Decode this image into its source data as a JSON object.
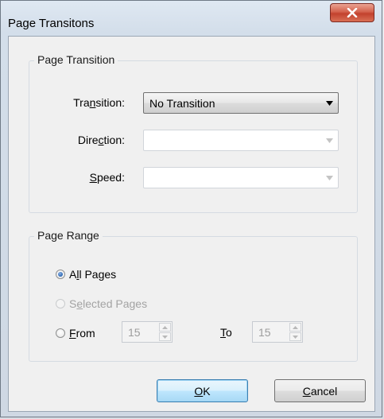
{
  "window": {
    "title": "Page Transitons",
    "close_icon": "close-x-icon",
    "accent_close_color": "#c7432e"
  },
  "page_transition": {
    "group_label": "Page Transition",
    "transition": {
      "label_pre": "Tra",
      "label_ul": "n",
      "label_post": "sition:",
      "value": "No Transition"
    },
    "direction": {
      "label_pre": "Dire",
      "label_ul": "c",
      "label_post": "tion:",
      "value": ""
    },
    "speed": {
      "label_pre": "",
      "label_ul": "S",
      "label_post": "peed:",
      "value": ""
    }
  },
  "page_range": {
    "group_label": "Page Range",
    "all_pages": {
      "label_pre": "A",
      "label_ul": "l",
      "label_post": "l Pages",
      "checked": true
    },
    "selected_pages": {
      "label_pre": "S",
      "label_ul": "e",
      "label_post": "lected Pages",
      "enabled": false
    },
    "from": {
      "label_pre": "",
      "label_ul": "F",
      "label_post": "rom",
      "value": "15"
    },
    "to": {
      "label_pre": "",
      "label_ul": "T",
      "label_post": "o",
      "value": "15"
    }
  },
  "buttons": {
    "ok": {
      "label_pre": "",
      "label_ul": "O",
      "label_post": "K"
    },
    "cancel": {
      "label_pre": "",
      "label_ul": "C",
      "label_post": "ancel"
    }
  }
}
